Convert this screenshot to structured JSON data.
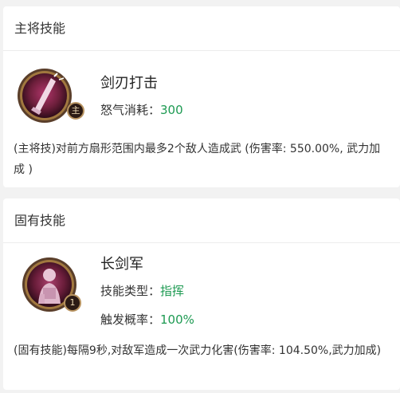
{
  "main_skill": {
    "header": "主将技能",
    "name": "剑刃打击",
    "badge": "主",
    "cost_label": "怒气消耗：",
    "cost_value": "300",
    "description": "(主将技)对前方扇形范围内最多2个敌人造成武 (伤害率: 550.00%, 武力加成 )",
    "icon": "sword-strike-icon"
  },
  "innate_skill": {
    "header": "固有技能",
    "name": "长剑军",
    "badge": "1",
    "type_label": "技能类型：",
    "type_value": "指挥",
    "chance_label": "触发概率：",
    "chance_value": "100%",
    "description": "(固有技能)每隔9秒,对敌军造成一次武力化害(伤害率: 104.50%,武力加成)",
    "icon": "longsword-soldier-icon"
  },
  "colors": {
    "value_green": "#1d9a52",
    "icon_ring": "#a1783f",
    "icon_fill": "#6e1f3c"
  }
}
